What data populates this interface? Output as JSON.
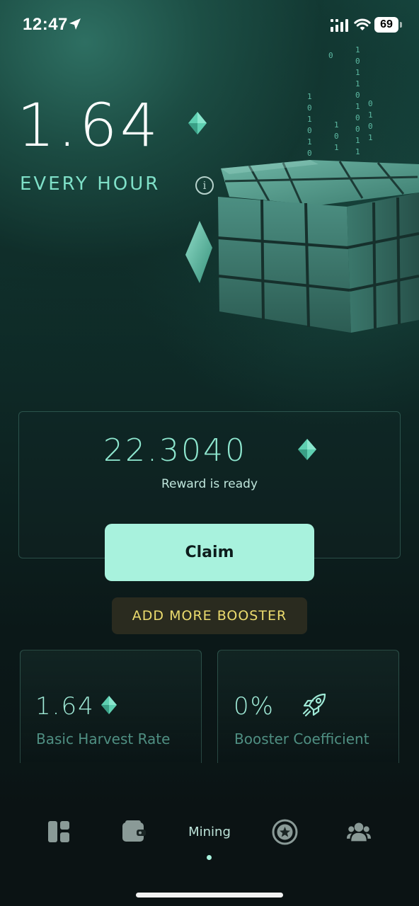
{
  "status_bar": {
    "time": "12:47",
    "battery": "69",
    "icons": [
      "location-arrow-icon",
      "signal-icon",
      "wifi-icon",
      "battery-icon"
    ]
  },
  "hero": {
    "rate": "1.64",
    "period": "EVERY HOUR",
    "icon": "gem-icon"
  },
  "reward": {
    "amount": "22.3040",
    "status": "Reward is ready"
  },
  "buttons": {
    "claim": "Claim",
    "booster": "ADD MORE BOOSTER"
  },
  "stats": {
    "harvest_value": "1.64",
    "harvest_label": "Basic Harvest Rate",
    "booster_value": "0%",
    "booster_label": "Booster Coefficient"
  },
  "nav": {
    "items": [
      {
        "name": "dashboard",
        "icon": "dashboard-icon"
      },
      {
        "name": "wallet",
        "icon": "wallet-icon"
      },
      {
        "name": "mining",
        "label": "Mining",
        "active": true
      },
      {
        "name": "rewards",
        "icon": "star-badge-icon"
      },
      {
        "name": "friends",
        "icon": "users-icon"
      }
    ]
  },
  "colors": {
    "accent": "#a8f2dd",
    "gem": "#5ecfb1",
    "booster_text": "#ecdc6e",
    "background": "#0b1314"
  }
}
